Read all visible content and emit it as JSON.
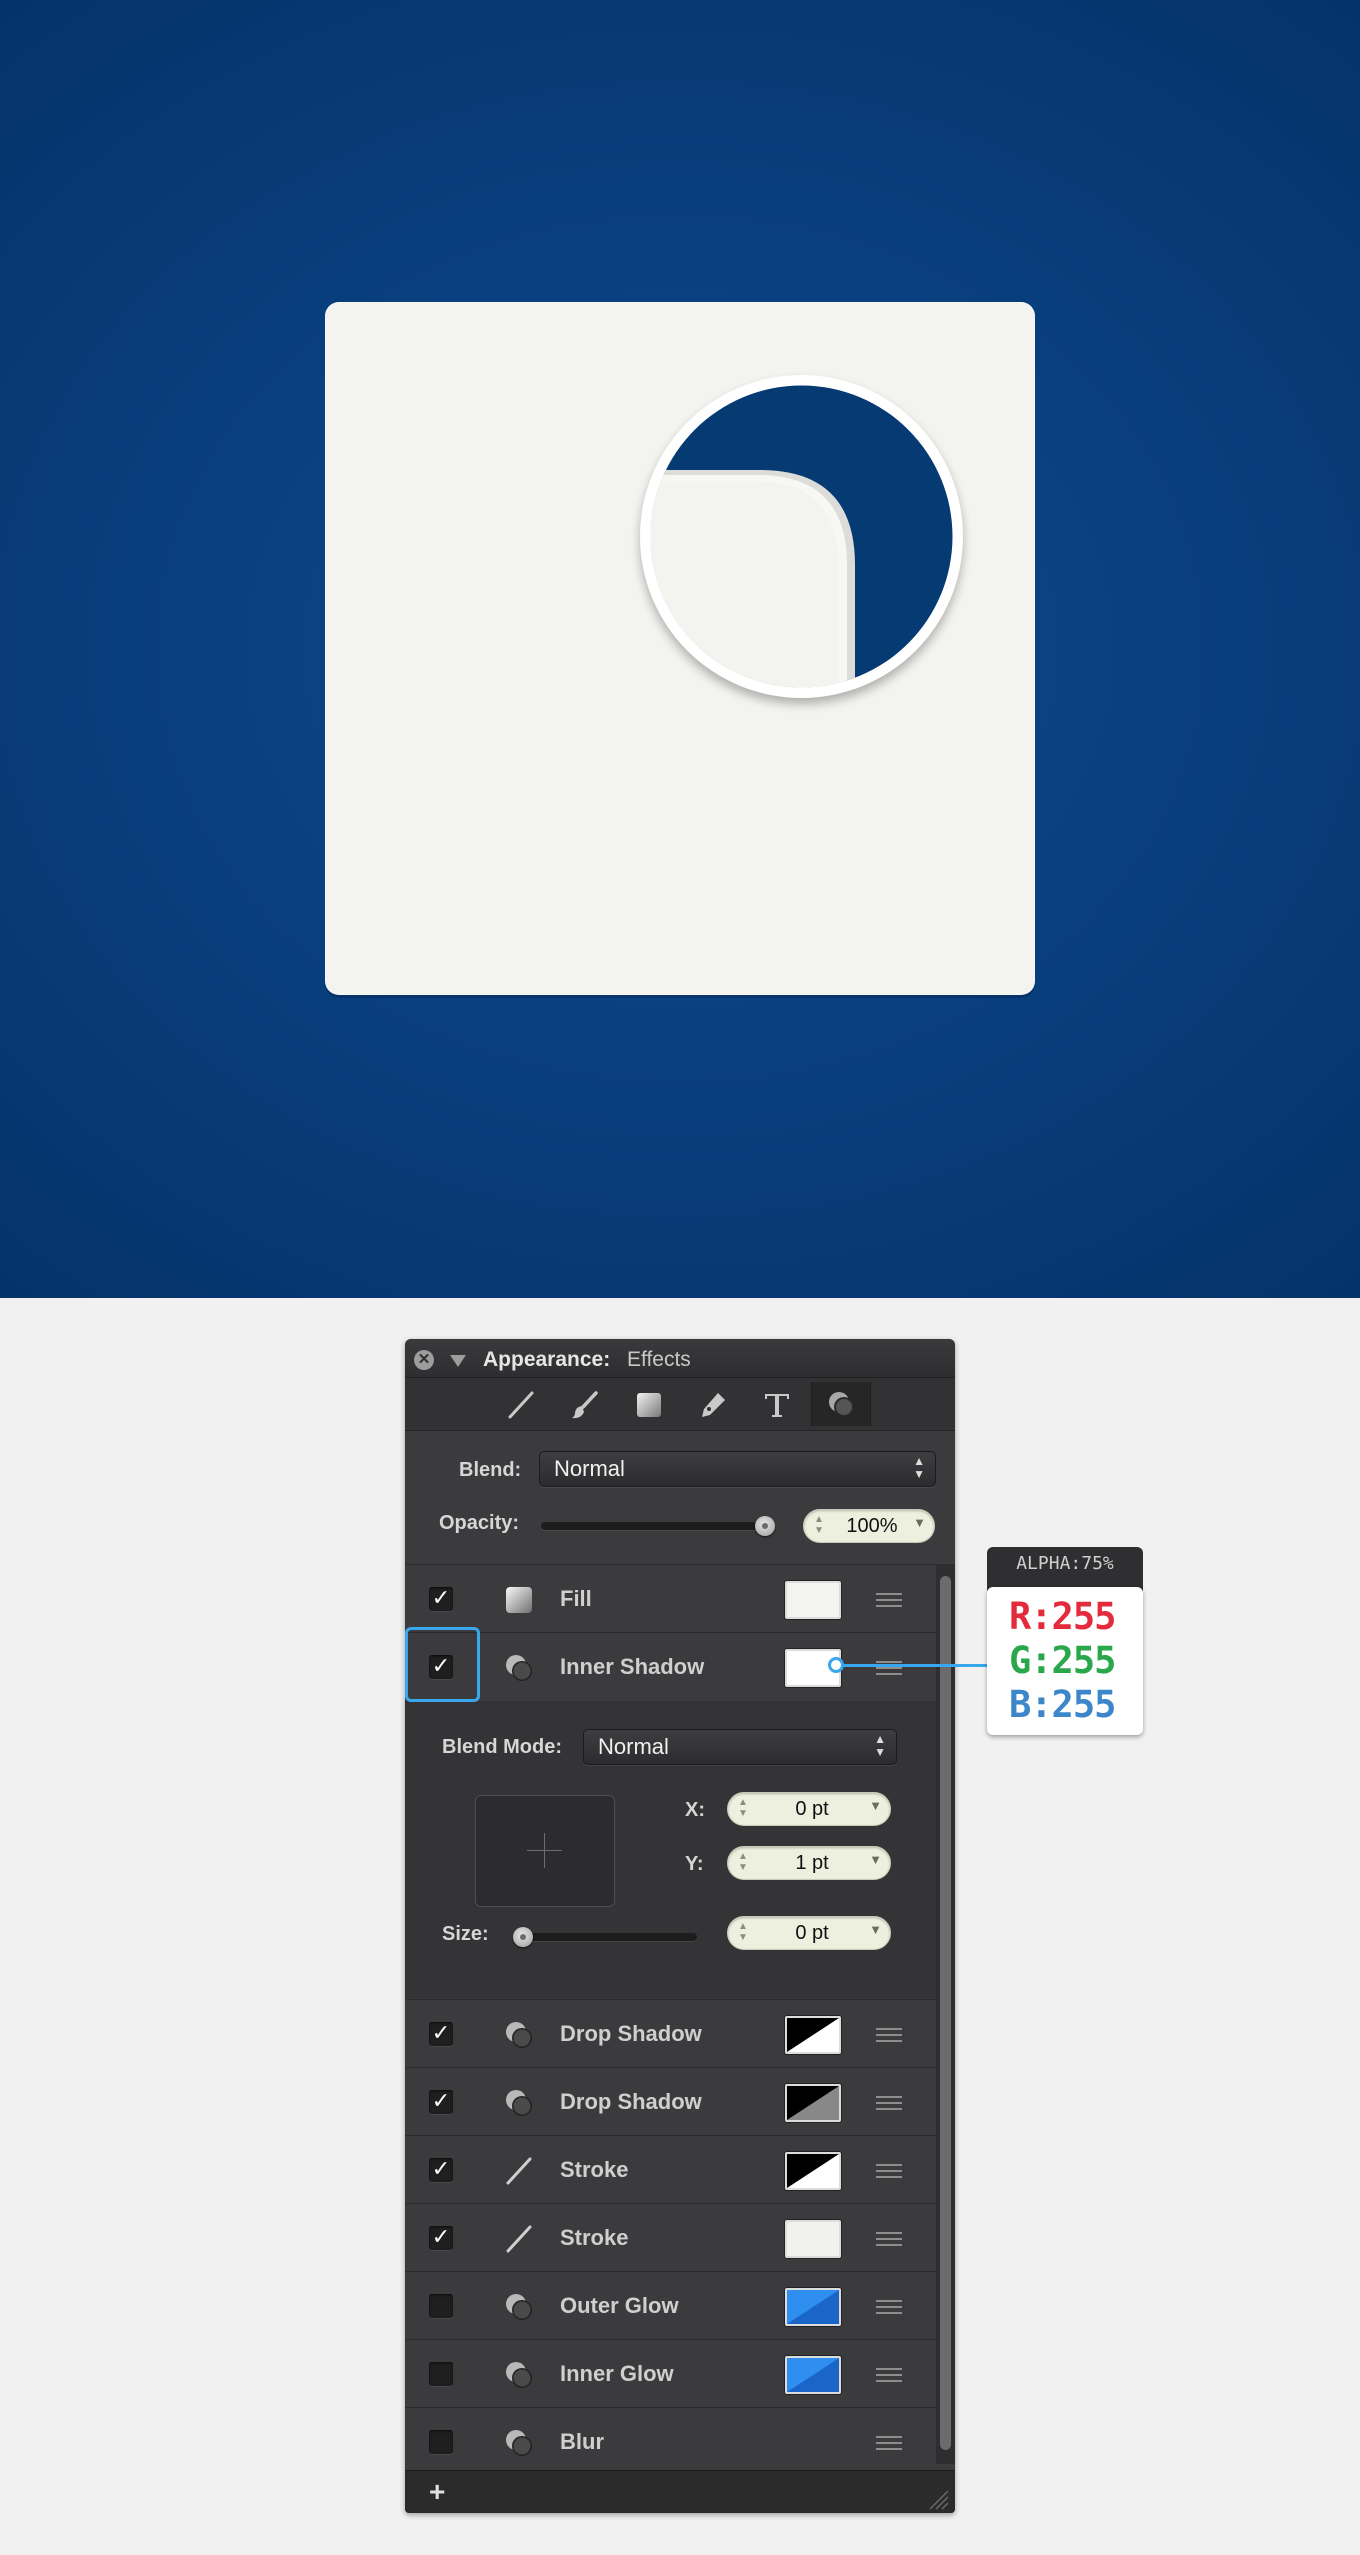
{
  "panel": {
    "title_label": "Appearance:",
    "title_value": "Effects",
    "close_glyph": "✕",
    "toolbar": [
      "stroke-tool",
      "brush-tool",
      "fill-tool",
      "pen-tool",
      "text-tool",
      "effects-tool"
    ],
    "blend_label": "Blend:",
    "blend_value": "Normal",
    "opacity_label": "Opacity:",
    "opacity_value": "100%",
    "opacity_level": 1.0,
    "effects": [
      {
        "name": "Fill",
        "checked": true,
        "icon": "fill-icon",
        "swatch": "#f3f4f0"
      },
      {
        "name": "Inner Shadow",
        "checked": true,
        "icon": "shadow-icon",
        "swatch": "#ffffff"
      },
      {
        "name": "Drop Shadow",
        "checked": true,
        "icon": "shadow-icon",
        "swatch": "black-white"
      },
      {
        "name": "Drop Shadow",
        "checked": true,
        "icon": "shadow-icon",
        "swatch": "black-gray"
      },
      {
        "name": "Stroke",
        "checked": true,
        "icon": "stroke-icon",
        "swatch": "black-white"
      },
      {
        "name": "Stroke",
        "checked": true,
        "icon": "stroke-icon",
        "swatch": "#f3f4f0"
      },
      {
        "name": "Outer Glow",
        "checked": false,
        "icon": "shadow-icon",
        "swatch": "blue"
      },
      {
        "name": "Inner Glow",
        "checked": false,
        "icon": "shadow-icon",
        "swatch": "blue"
      },
      {
        "name": "Blur",
        "checked": false,
        "icon": "shadow-icon",
        "swatch": null
      }
    ],
    "inner_shadow": {
      "blend_mode_label": "Blend Mode:",
      "blend_mode_value": "Normal",
      "x_label": "X:",
      "x_value": "0 pt",
      "y_label": "Y:",
      "y_value": "1 pt",
      "size_label": "Size:",
      "size_value": "0 pt",
      "size_level": 0.0
    },
    "add_glyph": "+"
  },
  "callout": {
    "alpha": "ALPHA:75%",
    "r": "R:255",
    "g": "G:255",
    "b": "B:255"
  },
  "colors": {
    "background_blue": "#0a4080",
    "card": "#f3f4f0",
    "highlight": "#37a7ee",
    "red": "#e32b3c",
    "green": "#2aa74a",
    "blue": "#3b87c9"
  }
}
